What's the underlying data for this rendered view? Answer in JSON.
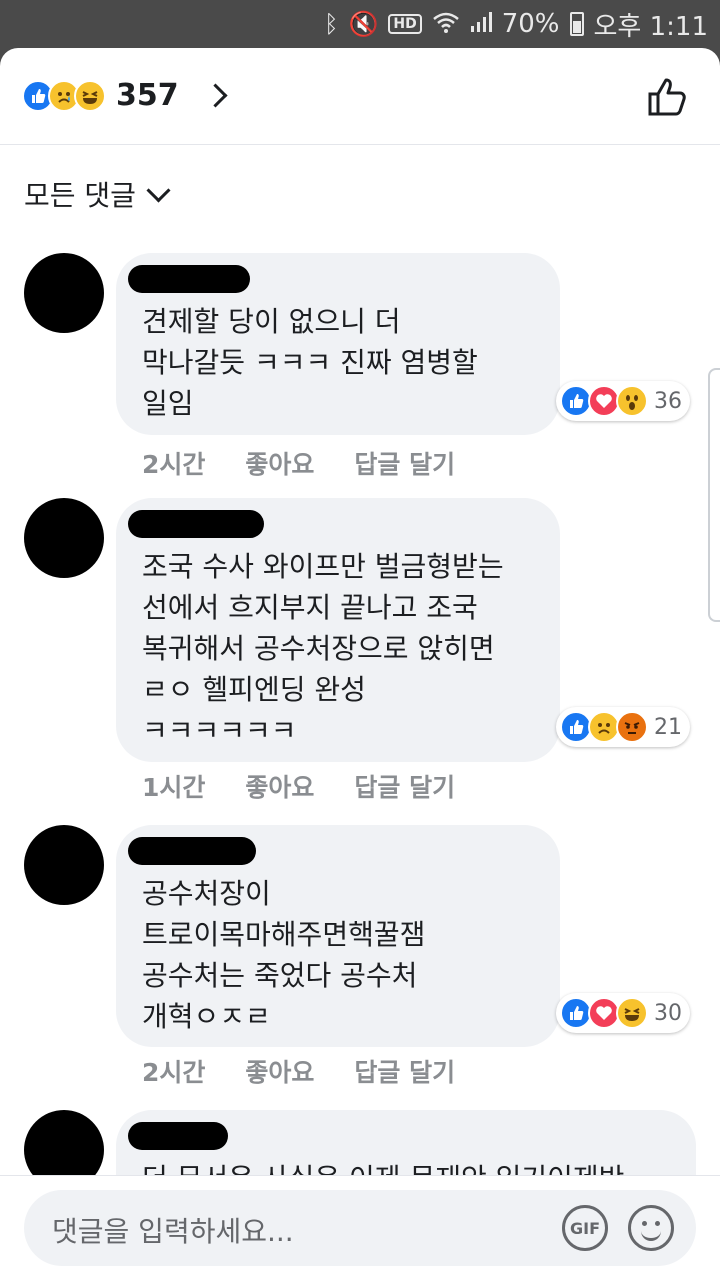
{
  "status_bar": {
    "battery": "70%",
    "time": "오후 1:11"
  },
  "header": {
    "reaction_count": "357"
  },
  "filter": {
    "label": "모든 댓글"
  },
  "comments": [
    {
      "text": "견제할 당이 없으니 더\n막나갈듯 ㅋㅋㅋ 진짜 염병할\n일임",
      "reactions": [
        "like",
        "love",
        "wow"
      ],
      "reaction_count": "36",
      "time": "2시간",
      "like_label": "좋아요",
      "reply_label": "답글 달기"
    },
    {
      "text": "조국 수사 와이프만 벌금형받는\n선에서 흐지부지 끝나고 조국\n복귀해서 공수처장으로 앉히면\nㄹㅇ 헬피엔딩 완성\nㅋㅋㅋㅋㅋㅋ",
      "reactions": [
        "like",
        "sad",
        "angry"
      ],
      "reaction_count": "21",
      "time": "1시간",
      "like_label": "좋아요",
      "reply_label": "답글 달기"
    },
    {
      "text": "공수처장이\n트로이목마해주면핵꿀잼\n공수처는 죽었다 공수처\n개혁ㅇㅈㄹ",
      "reactions": [
        "like",
        "love",
        "haha"
      ],
      "reaction_count": "30",
      "time": "2시간",
      "like_label": "좋아요",
      "reply_label": "답글 달기"
    },
    {
      "text": "더 무서운 사실은 이제 문재안 임기이제반"
    }
  ],
  "footer": {
    "placeholder": "댓글을 입력하세요...",
    "gif_label": "GIF"
  },
  "colors": {
    "like": "#1877f2",
    "love": "#f33e58",
    "face": "#f7c22d",
    "bubble": "#f0f2f5"
  }
}
